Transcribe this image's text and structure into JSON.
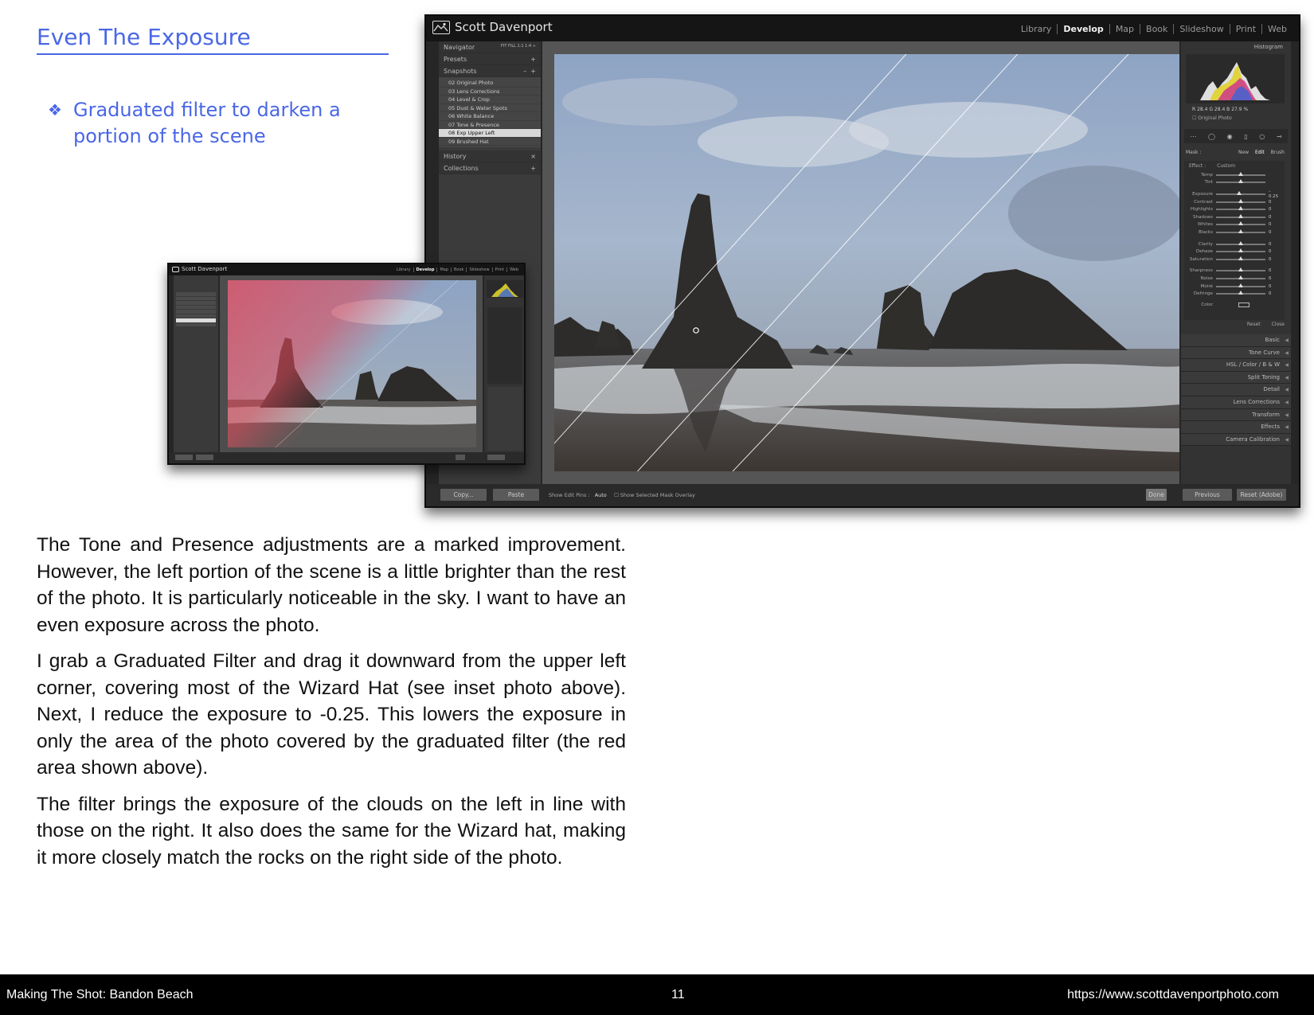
{
  "heading": {
    "title": "Even The Exposure",
    "bullet_glyph": "❖",
    "bullet_text": "Graduated filter to darken a portion of the scene"
  },
  "lightroom": {
    "brand": "Scott Davenport",
    "modules": [
      "Library",
      "Develop",
      "Map",
      "Book",
      "Slideshow",
      "Print",
      "Web"
    ],
    "active_module": "Develop",
    "left_panel": {
      "navigator": "Navigator",
      "navigator_zoom": "FIT   FILL   1:1   1:4 ÷",
      "presets": "Presets",
      "snapshots": "Snapshots",
      "snapshot_items": [
        "02 Original Photo",
        "03 Lens Corrections",
        "04 Level & Crop",
        "05 Dust & Water Spots",
        "06 White Balance",
        "07 Tone & Presence",
        "08 Exp Upper Left",
        "09 Brushed Hat"
      ],
      "selected_snapshot": "08 Exp Upper Left",
      "history": "History",
      "collections": "Collections"
    },
    "right_panel": {
      "histogram_label": "Histogram",
      "readout": "R  28.4   G  28.4   B  27.9 %",
      "original_photo": "Original Photo",
      "mask_label": "Mask :",
      "mask_modes": [
        "New",
        "Edit",
        "Brush"
      ],
      "effect_label": "Effect :",
      "effect_value": "Custom",
      "sliders": [
        {
          "label": "Temp",
          "value": "",
          "pos": 0.5
        },
        {
          "label": "Tint",
          "value": "",
          "pos": 0.5
        },
        {
          "label": "Exposure",
          "value": "– 0.25",
          "pos": 0.46
        },
        {
          "label": "Contrast",
          "value": "0",
          "pos": 0.5
        },
        {
          "label": "Highlights",
          "value": "0",
          "pos": 0.5
        },
        {
          "label": "Shadows",
          "value": "0",
          "pos": 0.5
        },
        {
          "label": "Whites",
          "value": "0",
          "pos": 0.5
        },
        {
          "label": "Blacks",
          "value": "0",
          "pos": 0.5
        },
        {
          "label": "Clarity",
          "value": "0",
          "pos": 0.5
        },
        {
          "label": "Dehaze",
          "value": "0",
          "pos": 0.5
        },
        {
          "label": "Saturation",
          "value": "0",
          "pos": 0.5
        },
        {
          "label": "Sharpness",
          "value": "0",
          "pos": 0.5
        },
        {
          "label": "Noise",
          "value": "0",
          "pos": 0.5
        },
        {
          "label": "Moiré",
          "value": "0",
          "pos": 0.5
        },
        {
          "label": "Defringe",
          "value": "0",
          "pos": 0.5
        }
      ],
      "color_label": "Color",
      "reset": "Reset",
      "close": "Close",
      "sections": [
        "Basic",
        "Tone Curve",
        "HSL  /  Color  /  B & W",
        "Split Toning",
        "Detail",
        "Lens Corrections",
        "Transform",
        "Effects",
        "Camera Calibration"
      ]
    },
    "bottom": {
      "copy": "Copy...",
      "paste": "Paste",
      "show_edit_pins": "Show Edit Pins :",
      "edit_pins_value": "Auto",
      "show_mask": "Show Selected Mask Overlay",
      "done": "Done",
      "previous": "Previous",
      "reset_adobe": "Reset (Adobe)"
    }
  },
  "body": {
    "paragraphs": [
      "The Tone and Presence adjustments are a marked improvement. However, the left portion of the scene is a little brighter than the rest of the photo. It is particularly noticeable in the sky. I want to have an even exposure across the photo.",
      "I grab a Graduated Filter and drag it downward from the upper left corner, covering most of the Wizard Hat (see inset photo above). Next, I reduce the exposure to -0.25. This lowers the exposure in only the area of the photo covered by the graduated filter (the red area shown above).",
      "The filter brings the exposure of the clouds on the left in line with those on the right. It also does the same for the Wizard hat, making it more closely match the rocks on the right side of the photo."
    ]
  },
  "footer": {
    "left": "Making The Shot: Bandon Beach",
    "page": "11",
    "url": "https://www.scottdavenportphoto.com"
  },
  "colors": {
    "accent": "#4a67e6",
    "footer_bg": "#000000",
    "mask_overlay": "#e03a3a"
  }
}
